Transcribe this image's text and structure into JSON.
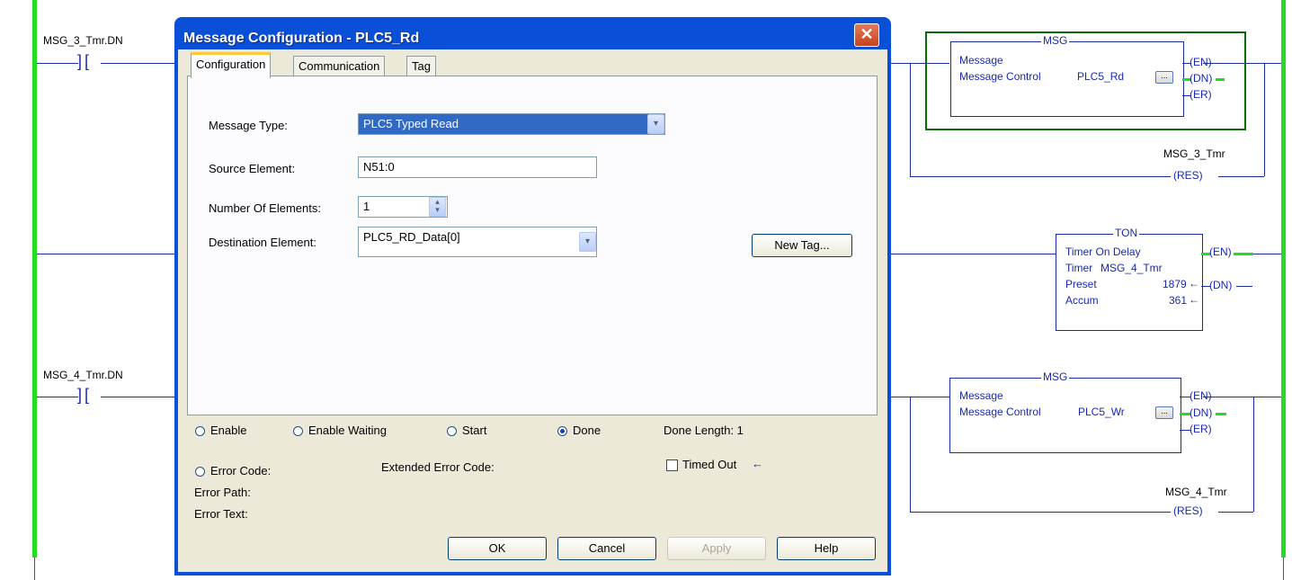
{
  "ladder": {
    "rung1": {
      "contact_tag": "MSG_3_Tmr.DN",
      "msg_title": "MSG",
      "msg_row1": "Message",
      "msg_row2_label": "Message Control",
      "msg_row2_value": "PLC5_Rd",
      "out_en": "(EN)",
      "out_dn": "(DN)",
      "out_er": "(ER)",
      "res_tag": "MSG_3_Tmr",
      "res_label": "(RES)"
    },
    "rung2": {
      "ton_title": "TON",
      "ton_row1": "Timer On Delay",
      "ton_timer_label": "Timer",
      "ton_timer_value": "MSG_4_Tmr",
      "ton_preset_label": "Preset",
      "ton_preset_value": "1879",
      "ton_accum_label": "Accum",
      "ton_accum_value": "361",
      "out_en": "(EN)",
      "out_dn": "(DN)"
    },
    "rung3": {
      "contact_tag": "MSG_4_Tmr.DN",
      "msg_title": "MSG",
      "msg_row1": "Message",
      "msg_row2_label": "Message Control",
      "msg_row2_value": "PLC5_Wr",
      "out_en": "(EN)",
      "out_dn": "(DN)",
      "out_er": "(ER)",
      "res_tag": "MSG_4_Tmr",
      "res_label": "(RES)"
    },
    "ellipsis": "...",
    "arrow": "←"
  },
  "dialog": {
    "title": "Message Configuration - PLC5_Rd",
    "close_glyph": "✕",
    "tabs": [
      "Configuration",
      "Communication",
      "Tag"
    ],
    "message_type_label": "Message Type:",
    "message_type_value": "PLC5 Typed Read",
    "source_element_label": "Source Element:",
    "source_element_value": "N51:0",
    "num_elements_label": "Number Of Elements:",
    "num_elements_value": "1",
    "dest_element_label": "Destination Element:",
    "dest_element_value": "PLC5_RD_Data[0]",
    "new_tag_button": "New Tag...",
    "status": {
      "enable": "Enable",
      "enable_waiting": "Enable Waiting",
      "start": "Start",
      "done": "Done",
      "done_length": "Done Length: 1",
      "error_code": "Error Code:",
      "extended_error_code": "Extended Error Code:",
      "timed_out": "Timed Out",
      "timed_out_arrow": "←",
      "error_path": "Error Path:",
      "error_text": "Error Text:"
    },
    "buttons": {
      "ok": "OK",
      "cancel": "Cancel",
      "apply": "Apply",
      "help": "Help"
    },
    "combo_arrow": "▾",
    "spin_up": "▴",
    "spin_down": "▾"
  },
  "colors": {
    "rail": "#22dd22",
    "wire": "#1a2ab0",
    "title_bar": "#0a4fd8",
    "dialog_face": "#ece9d8",
    "selected": "#316ac5",
    "enabled_box": "#0b6b0b"
  }
}
